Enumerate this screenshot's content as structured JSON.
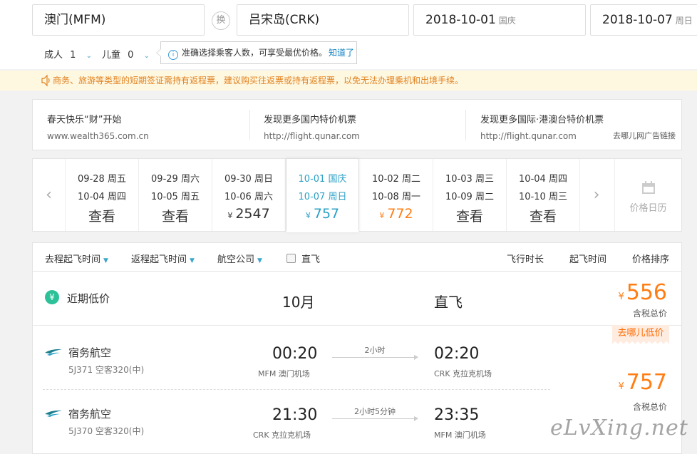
{
  "search": {
    "from": "澳门(MFM)",
    "swap_label": "换",
    "to": "吕宋岛(CRK)",
    "depart_date": "2018-10-01",
    "depart_note": "国庆",
    "return_date": "2018-10-07",
    "return_note": "周日",
    "adults_label": "成人",
    "adults_value": "1",
    "children_label": "儿童",
    "children_value": "0",
    "tip_text": "准确选择乘客人数，可享受最优价格。",
    "tip_link": "知道了"
  },
  "notice": {
    "text": "商务、旅游等类型的短期签证需持有返程票，建议购买往返票或持有返程票，以免无法办理乘机和出境手续。"
  },
  "ads": {
    "items": [
      {
        "title": "春天快乐“财”开始",
        "url": "www.wealth365.com.cn"
      },
      {
        "title": "发现更多国内特价机票",
        "url": "http://flight.qunar.com"
      },
      {
        "title": "发现更多国际·港澳台特价机票",
        "url": "http://flight.qunar.com"
      }
    ],
    "link": "去哪儿网广告链接"
  },
  "date_strip": {
    "currency": "¥",
    "cells": [
      {
        "dep": "09-28 周五",
        "ret": "10-04 周四",
        "price": "查看"
      },
      {
        "dep": "09-29 周六",
        "ret": "10-05 周五",
        "price": "查看"
      },
      {
        "dep": "09-30 周日",
        "ret": "10-06 周六",
        "price": "2547"
      },
      {
        "dep": "10-01 国庆",
        "ret": "10-07 周日",
        "price": "757"
      },
      {
        "dep": "10-02 周二",
        "ret": "10-08 周一",
        "price": "772"
      },
      {
        "dep": "10-03 周三",
        "ret": "10-09 周二",
        "price": "查看"
      },
      {
        "dep": "10-04 周四",
        "ret": "10-10 周三",
        "price": "查看"
      }
    ],
    "calendar_label": "价格日历"
  },
  "filters": {
    "go_time": "去程起飞时间",
    "return_time": "返程起飞时间",
    "airline": "航空公司",
    "direct": "直飞",
    "sort_duration": "飞行时长",
    "sort_depart": "起飞时间",
    "sort_price": "价格排序"
  },
  "low_price": {
    "icon": "¥",
    "label": "近期低价",
    "month": "10月",
    "type": "直飞",
    "currency": "¥",
    "price": "556",
    "tax_note": "含税总价"
  },
  "result": {
    "tag": "去哪儿低价",
    "currency": "¥",
    "price": "757",
    "tax_note": "含税总价",
    "legs": [
      {
        "airline": "宿务航空",
        "flight": "5J371 空客320(中)",
        "dep_time": "00:20",
        "dep_airport": "MFM 澳门机场",
        "duration": "2小时",
        "arr_time": "02:20",
        "arr_airport": "CRK 克拉克机场"
      },
      {
        "airline": "宿务航空",
        "flight": "5J370 空客320(中)",
        "dep_time": "21:30",
        "dep_airport": "CRK 克拉克机场",
        "duration": "2小时5分钟",
        "arr_time": "23:35",
        "arr_airport": "MFM 澳门机场"
      }
    ]
  },
  "watermark": "eLvXing.net",
  "colors": {
    "accent": "#2aa0c6",
    "price": "#ff7d13",
    "notice_bg": "#fff8e1",
    "green": "#2cc199"
  }
}
